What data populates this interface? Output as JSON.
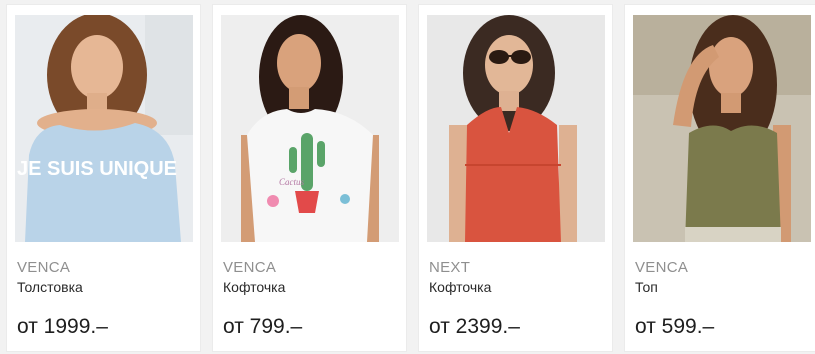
{
  "products": [
    {
      "brand": "VENCA",
      "title": "Толстовка",
      "price": "от 1999.–",
      "print_text": "JE SUIS UNIQUE",
      "image": "model-light-blue-sweatshirt"
    },
    {
      "brand": "VENCA",
      "title": "Кофточка",
      "price": "от 799.–",
      "print_text": "Cactus",
      "image": "model-white-tee-cactus"
    },
    {
      "brand": "NEXT",
      "title": "Кофточка",
      "price": "от 2399.–",
      "image": "model-red-lace-blouse-sunglasses"
    },
    {
      "brand": "VENCA",
      "title": "Топ",
      "price": "от 599.–",
      "image": "model-khaki-tank-top"
    }
  ],
  "colors": {
    "card_background": "#ffffff",
    "page_background": "#f2f2f2",
    "brand_text": "#8f8f8f",
    "price_text": "#1e1e1e",
    "sweatshirt": "#b9d3e8",
    "tee": "#f7f7f7",
    "blouse": "#d9543f",
    "tank": "#7b7a4c"
  }
}
